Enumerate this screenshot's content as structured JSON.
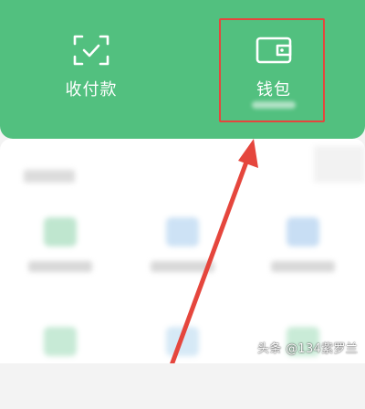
{
  "services": {
    "pay": {
      "label": "收付款",
      "icon": "scan-check-icon"
    },
    "wallet": {
      "label": "钱包",
      "icon": "wallet-icon"
    }
  },
  "watermark": {
    "text": "头条 @134紫罗兰"
  },
  "colors": {
    "card_green": "#52c07f",
    "highlight_red": "#e5463d"
  }
}
